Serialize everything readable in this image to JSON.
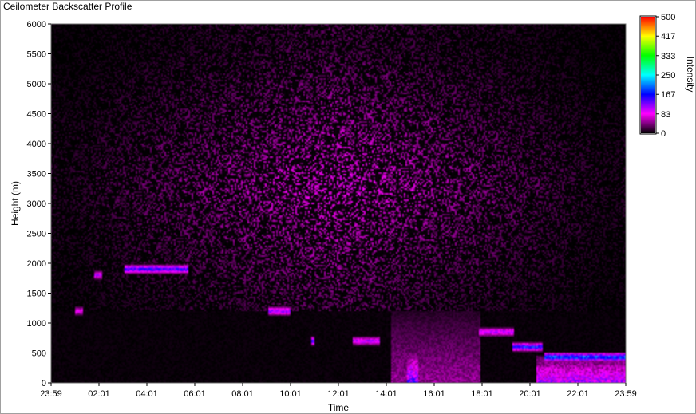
{
  "window": {
    "title": "Ceilometer Backscatter Profile"
  },
  "chart_data": {
    "type": "heatmap",
    "title": "Ceilometer Backscatter Profile",
    "xlabel": "Time",
    "ylabel": "Height (m)",
    "x_ticks": [
      "23:59",
      "02:01",
      "04:01",
      "06:01",
      "08:01",
      "10:01",
      "12:01",
      "14:01",
      "16:01",
      "18:01",
      "20:01",
      "22:01",
      "23:59"
    ],
    "y_ticks": [
      0,
      500,
      1000,
      1500,
      2000,
      2500,
      3000,
      3500,
      4000,
      4500,
      5000,
      5500,
      6000
    ],
    "ylim": [
      0,
      6000
    ],
    "x_range_hours": [
      0,
      24
    ],
    "colorbar": {
      "label": "Intensity",
      "ticks": [
        0,
        83,
        167,
        250,
        333,
        417,
        500
      ],
      "range": [
        0,
        500
      ],
      "colors": [
        "#000000",
        "#ff00ff",
        "#0000ff",
        "#00ffff",
        "#00ff00",
        "#ffff00",
        "#ff0000"
      ]
    },
    "background_noise": {
      "height_range_m": [
        1200,
        6000
      ],
      "typical_intensity": 60,
      "peak_height_m": 3300
    },
    "cloud_layers": [
      {
        "start_h": 1.0,
        "end_h": 1.35,
        "height_m": 1200,
        "intensity": 95
      },
      {
        "start_h": 1.8,
        "end_h": 2.1,
        "height_m": 1800,
        "intensity": 110
      },
      {
        "start_h": 3.1,
        "end_h": 5.7,
        "height_m": 1900,
        "intensity": 170
      },
      {
        "start_h": 9.1,
        "end_h": 10.0,
        "height_m": 1200,
        "intensity": 140
      },
      {
        "start_h": 10.9,
        "end_h": 11.0,
        "height_m": 700,
        "intensity": 170
      },
      {
        "start_h": 12.6,
        "end_h": 13.7,
        "height_m": 700,
        "intensity": 120
      },
      {
        "start_h": 17.9,
        "end_h": 19.3,
        "height_m": 850,
        "intensity": 120
      },
      {
        "start_h": 19.3,
        "end_h": 20.5,
        "height_m": 600,
        "intensity": 180
      },
      {
        "start_h": 20.6,
        "end_h": 24.0,
        "height_m": 430,
        "intensity": 220
      }
    ],
    "boundary_layer": [
      {
        "start_h": 14.2,
        "end_h": 17.9,
        "top_m": 1200,
        "intensity": 60
      },
      {
        "start_h": 14.9,
        "end_h": 15.3,
        "top_m": 500,
        "intensity": 160
      },
      {
        "start_h": 20.3,
        "end_h": 24.0,
        "top_m": 450,
        "intensity": 130
      }
    ]
  }
}
